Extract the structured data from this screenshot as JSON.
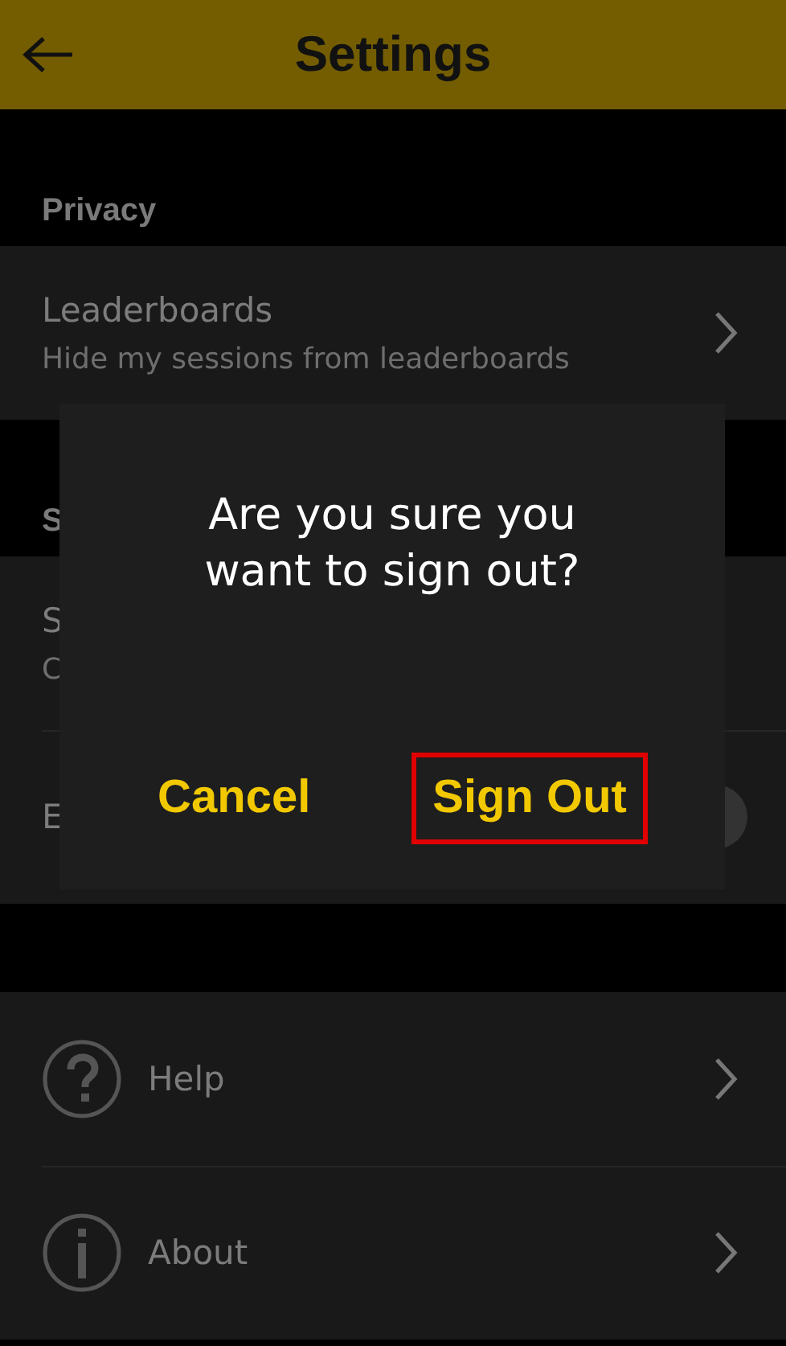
{
  "header": {
    "title": "Settings"
  },
  "sections": [
    {
      "title": "Privacy",
      "rows": [
        {
          "kind": "link",
          "title": "Leaderboards",
          "subtitle": "Hide my sessions from leaderboards"
        }
      ]
    },
    {
      "title": "S",
      "rows": [
        {
          "kind": "plain",
          "title": "S",
          "subtitle": "C"
        },
        {
          "kind": "toggle",
          "title": "E",
          "on": true
        }
      ]
    },
    {
      "rows": [
        {
          "kind": "link",
          "title": "Help"
        },
        {
          "kind": "link",
          "title": "About"
        }
      ]
    }
  ],
  "dialog": {
    "message": "Are you sure you want to sign out?",
    "buttons": [
      {
        "label": "Cancel",
        "highlighted": false
      },
      {
        "label": "Sign Out",
        "highlighted": true
      }
    ]
  }
}
